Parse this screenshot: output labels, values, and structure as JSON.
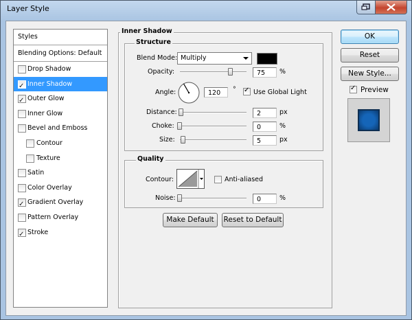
{
  "window": {
    "title": "Layer Style"
  },
  "sidebar": {
    "styles_label": "Styles",
    "blending_label": "Blending Options: Default",
    "items": [
      {
        "label": "Drop Shadow",
        "checked": false
      },
      {
        "label": "Inner Shadow",
        "checked": true
      },
      {
        "label": "Outer Glow",
        "checked": true
      },
      {
        "label": "Inner Glow",
        "checked": false
      },
      {
        "label": "Bevel and Emboss",
        "checked": false
      },
      {
        "label": "Contour",
        "checked": false
      },
      {
        "label": "Texture",
        "checked": false
      },
      {
        "label": "Satin",
        "checked": false
      },
      {
        "label": "Color Overlay",
        "checked": false
      },
      {
        "label": "Gradient Overlay",
        "checked": true
      },
      {
        "label": "Pattern Overlay",
        "checked": false
      },
      {
        "label": "Stroke",
        "checked": true
      }
    ]
  },
  "panel": {
    "title": "Inner Shadow",
    "structure": {
      "legend": "Structure",
      "blend_mode_label": "Blend Mode:",
      "blend_mode_value": "Multiply",
      "shadow_color": "#000000",
      "opacity_label": "Opacity:",
      "opacity_value": "75",
      "opacity_unit": "%",
      "opacity_level": 0.75,
      "angle_label": "Angle:",
      "angle_value": "120",
      "angle_unit": "°",
      "use_global_light_label": "Use Global Light",
      "use_global_light": true,
      "distance_label": "Distance:",
      "distance_value": "2",
      "distance_unit": "px",
      "choke_label": "Choke:",
      "choke_value": "0",
      "choke_unit": "%",
      "size_label": "Size:",
      "size_value": "5",
      "size_unit": "px"
    },
    "quality": {
      "legend": "Quality",
      "contour_label": "Contour:",
      "anti_aliased_label": "Anti-aliased",
      "anti_aliased": false,
      "noise_label": "Noise:",
      "noise_value": "0",
      "noise_unit": "%"
    },
    "make_default_label": "Make Default",
    "reset_default_label": "Reset to Default"
  },
  "actions": {
    "ok_label": "OK",
    "reset_label": "Reset",
    "new_style_label": "New Style...",
    "preview_label": "Preview",
    "preview_checked": true
  },
  "colors": {
    "selection": "#3399ff",
    "preview_fill": "#1565b8"
  }
}
